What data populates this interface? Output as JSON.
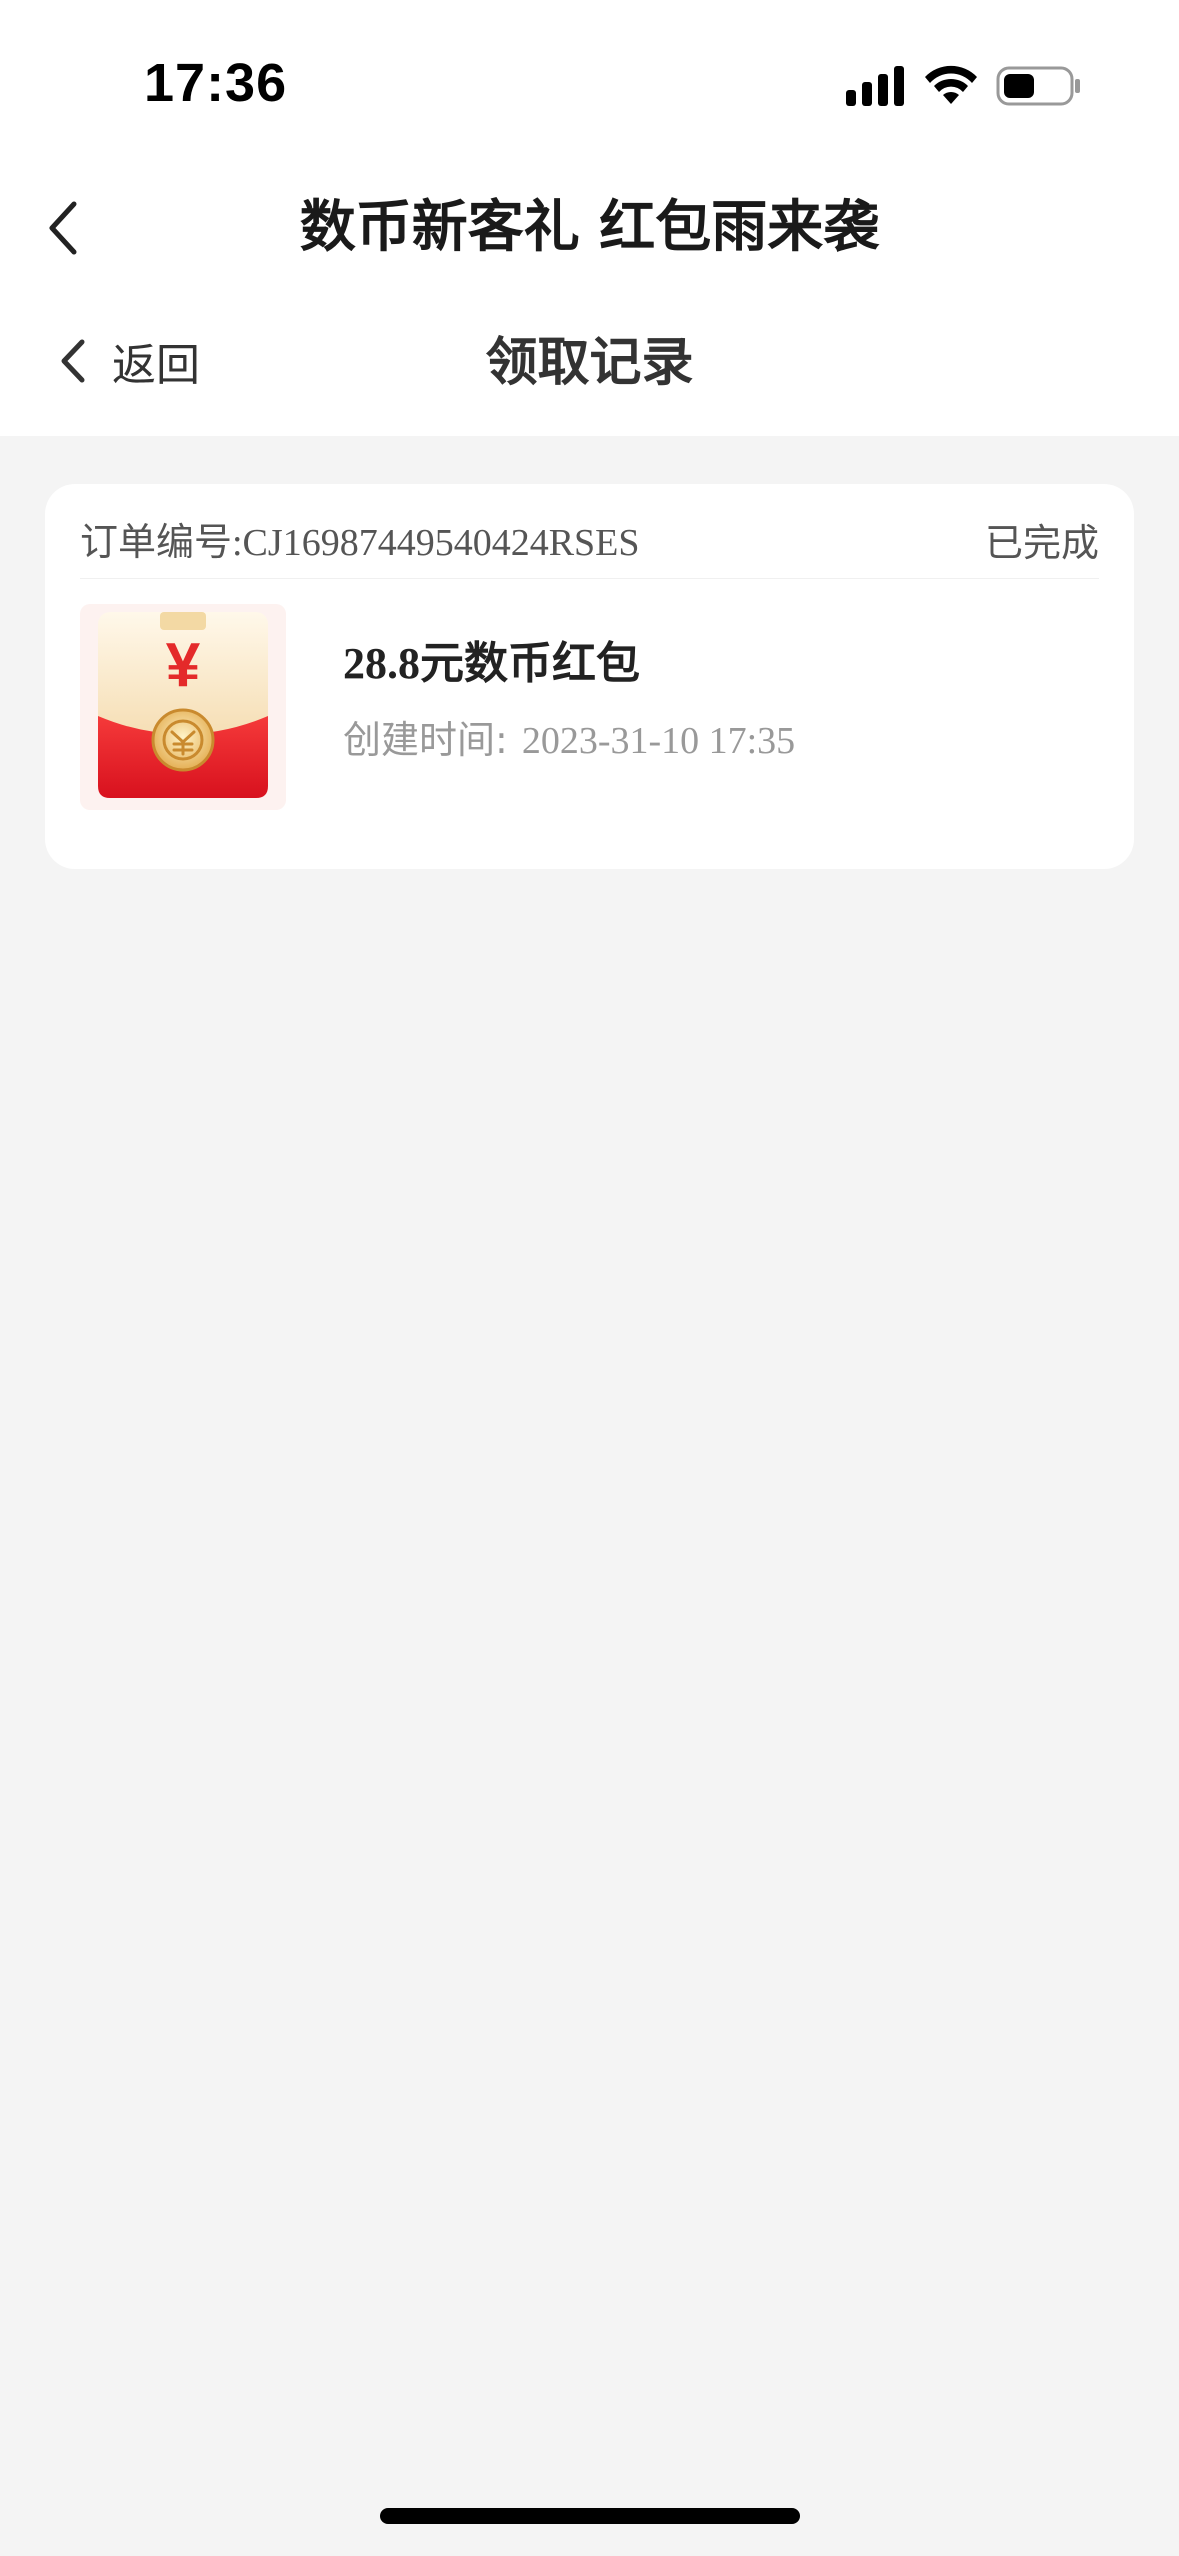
{
  "status_bar": {
    "time": "17:36"
  },
  "nav": {
    "title": "数币新客礼 红包雨来袭"
  },
  "sub_header": {
    "back_label": "返回",
    "title": "领取记录"
  },
  "record": {
    "order_number": "订单编号:CJ16987449540424RSES",
    "status": "已完成",
    "gift_name": "28.8元数币红包",
    "time_label": "创建时间:",
    "time_value": "2023-31-10 17:35"
  },
  "colors": {
    "page_bg": "#f4f4f4",
    "card_bg": "#ffffff",
    "envelope_red": "#e8202a",
    "envelope_cream": "#fbe8c6",
    "coin_gold": "#e8b45a"
  },
  "icons": {
    "signal": "cellular-signal-icon",
    "wifi": "wifi-icon",
    "battery": "battery-icon",
    "back": "chevron-left-icon",
    "gift": "red-envelope-icon"
  }
}
